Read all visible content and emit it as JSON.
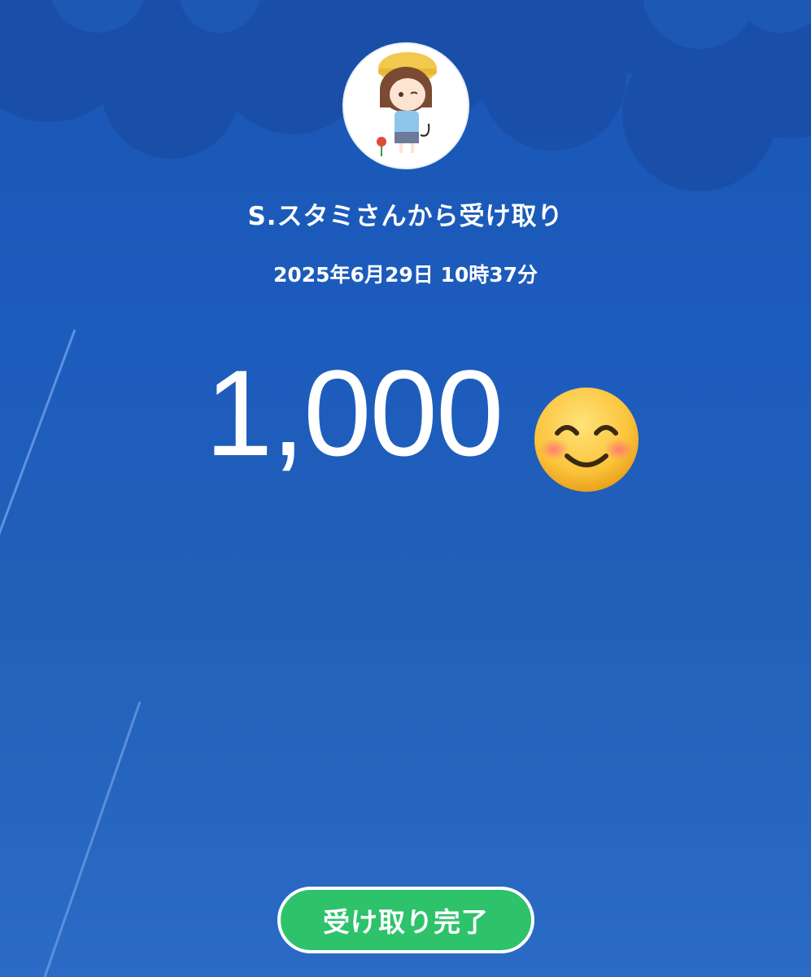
{
  "sender": {
    "avatar_icon": "avatar-character-icon",
    "title": "S.スタミさんから受け取り",
    "timestamp": "2025年6月29日 10時37分"
  },
  "amount": {
    "value": "1,000",
    "emoji_icon": "smiling-face-emoji-icon"
  },
  "actions": {
    "complete_label": "受け取り完了"
  },
  "colors": {
    "background_top": "#1a56b4",
    "background_bottom": "#2a6bc6",
    "button": "#2ec26b",
    "text": "#ffffff"
  }
}
